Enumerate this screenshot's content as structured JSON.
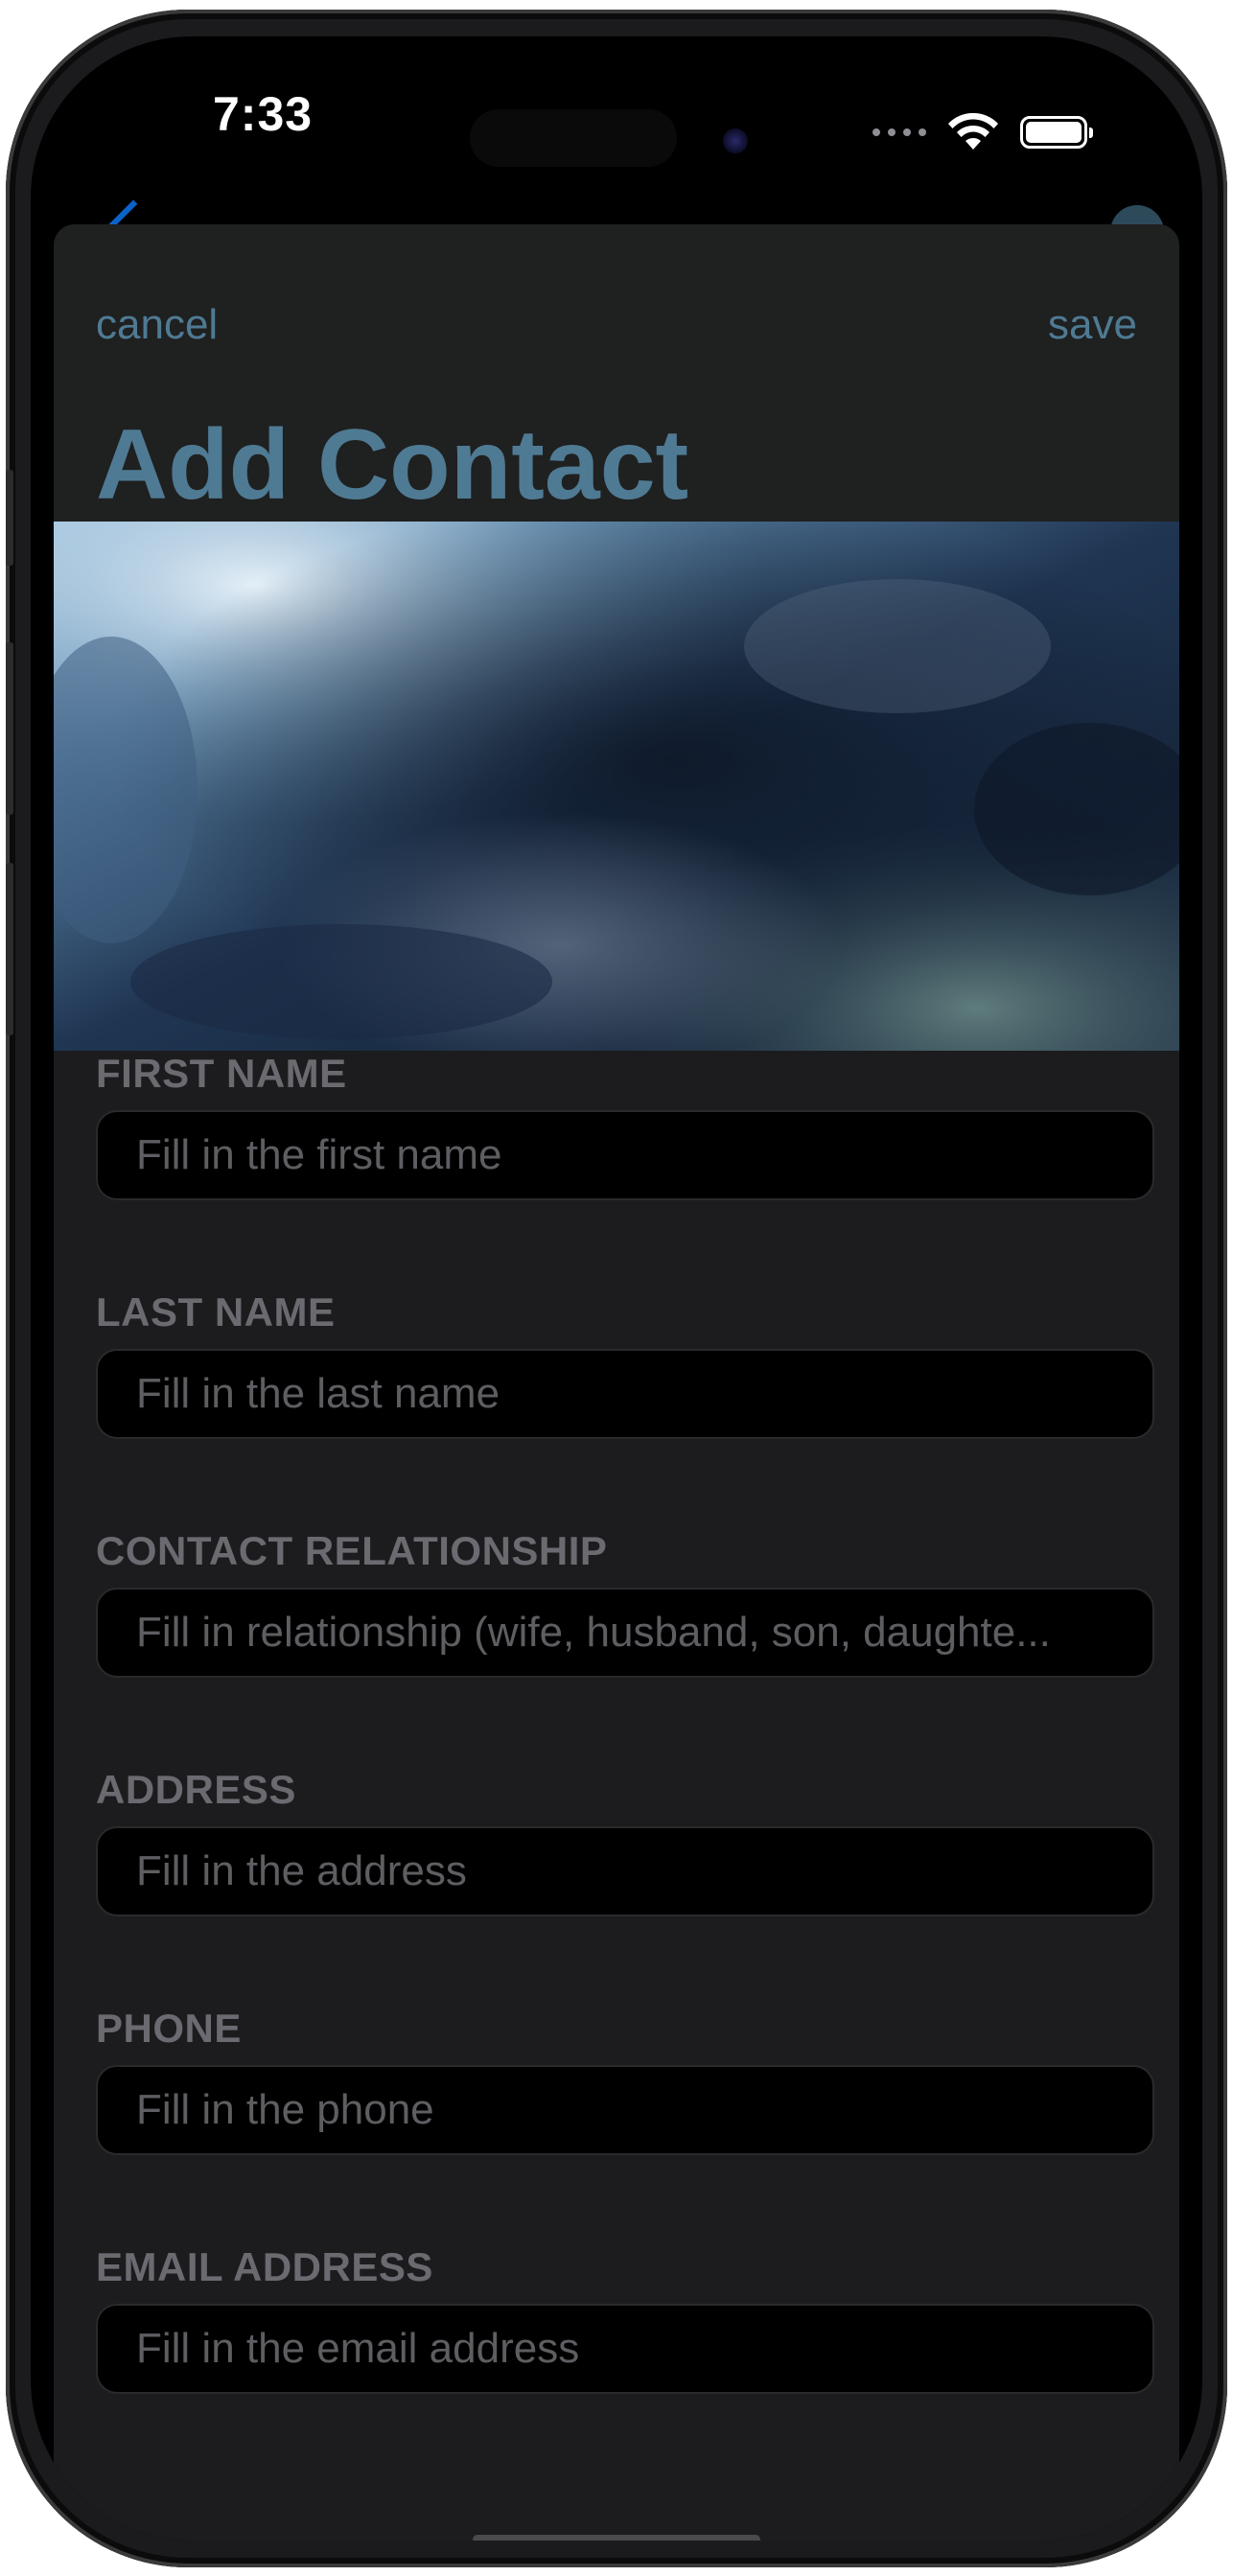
{
  "status_bar": {
    "time": "7:33",
    "icons": [
      "cellular-signal-icon",
      "wifi-icon",
      "battery-icon"
    ]
  },
  "nav": {
    "cancel_label": "cancel",
    "save_label": "save"
  },
  "page_title": "Add Contact",
  "hero_image": "storm-clouds-photo",
  "colors": {
    "accent": "#4f7a93",
    "sheet_background": "#1c1c1e",
    "input_background": "#000000",
    "label": "#6a6a70",
    "placeholder": "#5e5e62"
  },
  "fields": [
    {
      "label": "FIRST NAME",
      "placeholder": "Fill in the first name",
      "value": ""
    },
    {
      "label": "LAST NAME",
      "placeholder": "Fill in the last name",
      "value": ""
    },
    {
      "label": "CONTACT RELATIONSHIP",
      "placeholder": "Fill in relationship (wife, husband, son, daughte...",
      "value": ""
    },
    {
      "label": "ADDRESS",
      "placeholder": "Fill in the address",
      "value": ""
    },
    {
      "label": "PHONE",
      "placeholder": "Fill in the phone",
      "value": ""
    },
    {
      "label": "EMAIL ADDRESS",
      "placeholder": "Fill in the email address",
      "value": ""
    }
  ]
}
